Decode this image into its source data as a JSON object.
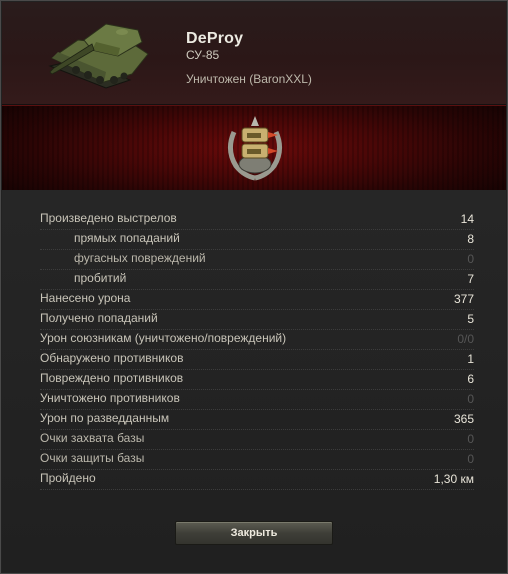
{
  "header": {
    "player_name": "DeProy",
    "vehicle_name": "СУ-85",
    "status": "Уничтожен (BaronXXL)"
  },
  "icons": {
    "tank": "tank-silhouette-icon",
    "medal": "achievement-medal-icon"
  },
  "colors": {
    "banner_red": "#6a0a0a",
    "zero_value": "#565656"
  },
  "stats": [
    {
      "label": "Произведено выстрелов",
      "value": "14"
    },
    {
      "label": "прямых попаданий",
      "value": "8"
    },
    {
      "label": "фугасных повреждений",
      "value": "0"
    },
    {
      "label": "пробитий",
      "value": "7"
    },
    {
      "label": "Нанесено урона",
      "value": "377"
    },
    {
      "label": "Получено попаданий",
      "value": "5"
    },
    {
      "label": "Урон союзникам (уничтожено/повреждений)",
      "value": "0/0"
    },
    {
      "label": "Обнаружено противников",
      "value": "1"
    },
    {
      "label": "Повреждено противников",
      "value": "6"
    },
    {
      "label": "Уничтожено противников",
      "value": "0"
    },
    {
      "label": "Урон по разведданным",
      "value": "365"
    },
    {
      "label": "Очки захвата базы",
      "value": "0"
    },
    {
      "label": "Очки защиты базы",
      "value": "0"
    },
    {
      "label": "Пройдено",
      "value": "1,30 км"
    }
  ],
  "buttons": {
    "close_label": "Закрыть"
  }
}
